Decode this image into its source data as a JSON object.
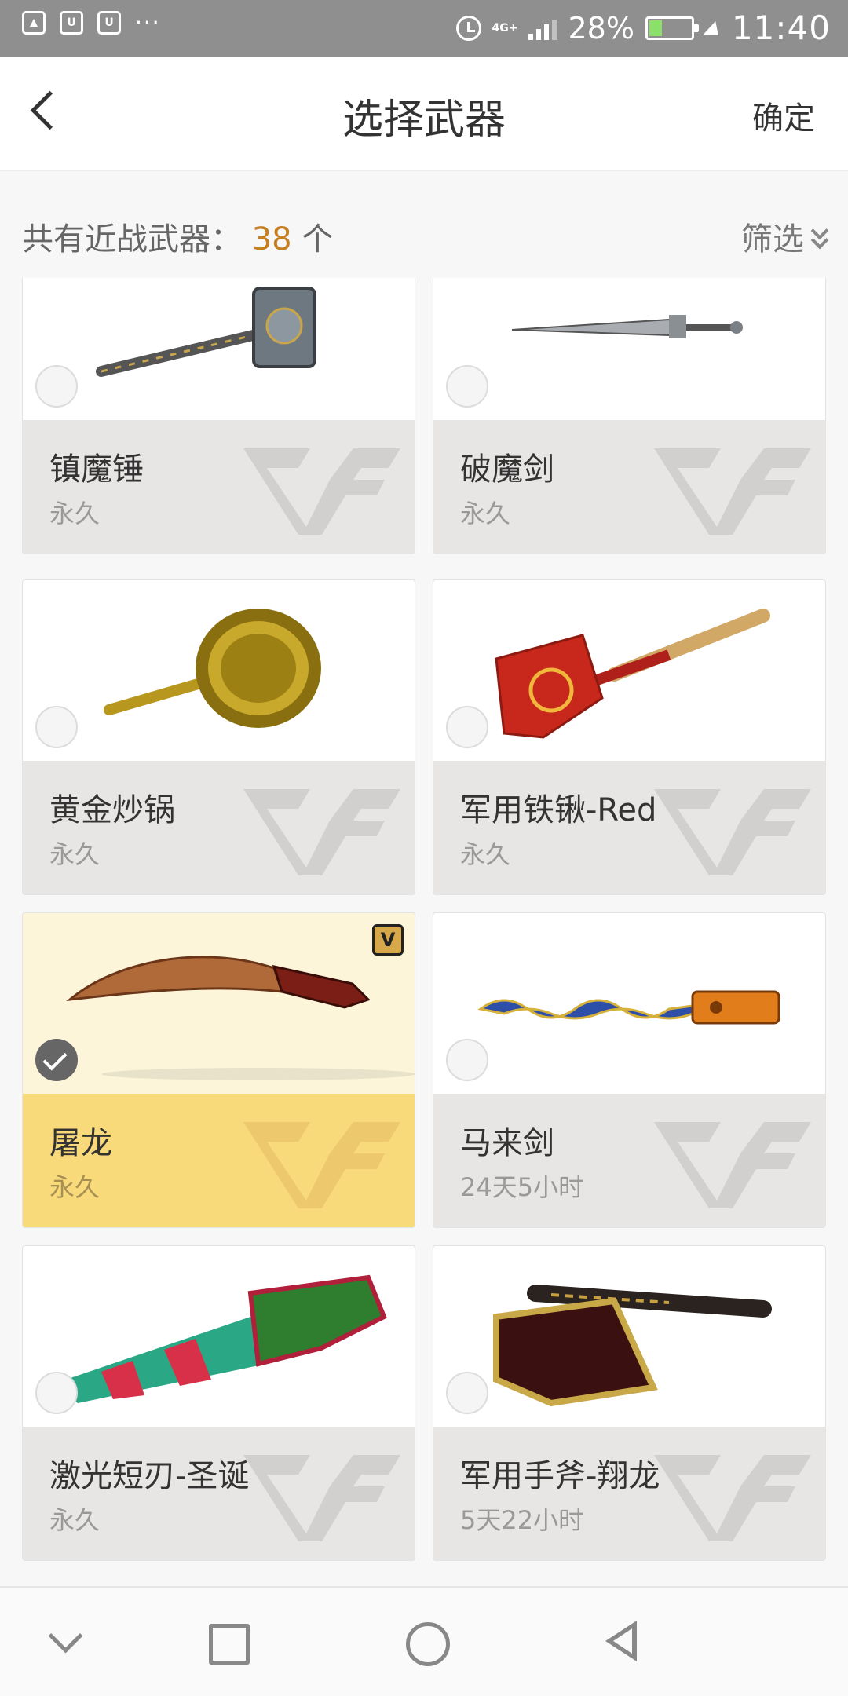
{
  "status_bar": {
    "notification_icons": [
      "image-icon",
      "app-icon",
      "app-icon"
    ],
    "more": "···",
    "network": "4G+",
    "battery_percent": "28%",
    "battery_level": 0.28,
    "time": "11:40"
  },
  "header": {
    "title": "选择武器",
    "confirm_label": "确定"
  },
  "summary": {
    "label": "共有近战武器：",
    "count": "38",
    "unit": "个",
    "filter_label": "筛选"
  },
  "weapons": [
    {
      "name": "镇魔锤",
      "duration": "永久",
      "selected": false
    },
    {
      "name": "破魔剑",
      "duration": "永久",
      "selected": false
    },
    {
      "name": "黄金炒锅",
      "duration": "永久",
      "selected": false
    },
    {
      "name": "军用铁锹-Red",
      "duration": "永久",
      "selected": false
    },
    {
      "name": "屠龙",
      "duration": "永久",
      "selected": true,
      "vip": "V"
    },
    {
      "name": "马来剑",
      "duration": "24天5小时",
      "selected": false
    },
    {
      "name": "激光短刃-圣诞",
      "duration": "永久",
      "selected": false
    },
    {
      "name": "军用手斧-翔龙",
      "duration": "5天22小时",
      "selected": false
    }
  ],
  "colors": {
    "accent_count": "#c67f1e",
    "selected_top": "#fcf5d9",
    "selected_info": "#f8da7a",
    "status_bar": "#8f8f8f"
  }
}
